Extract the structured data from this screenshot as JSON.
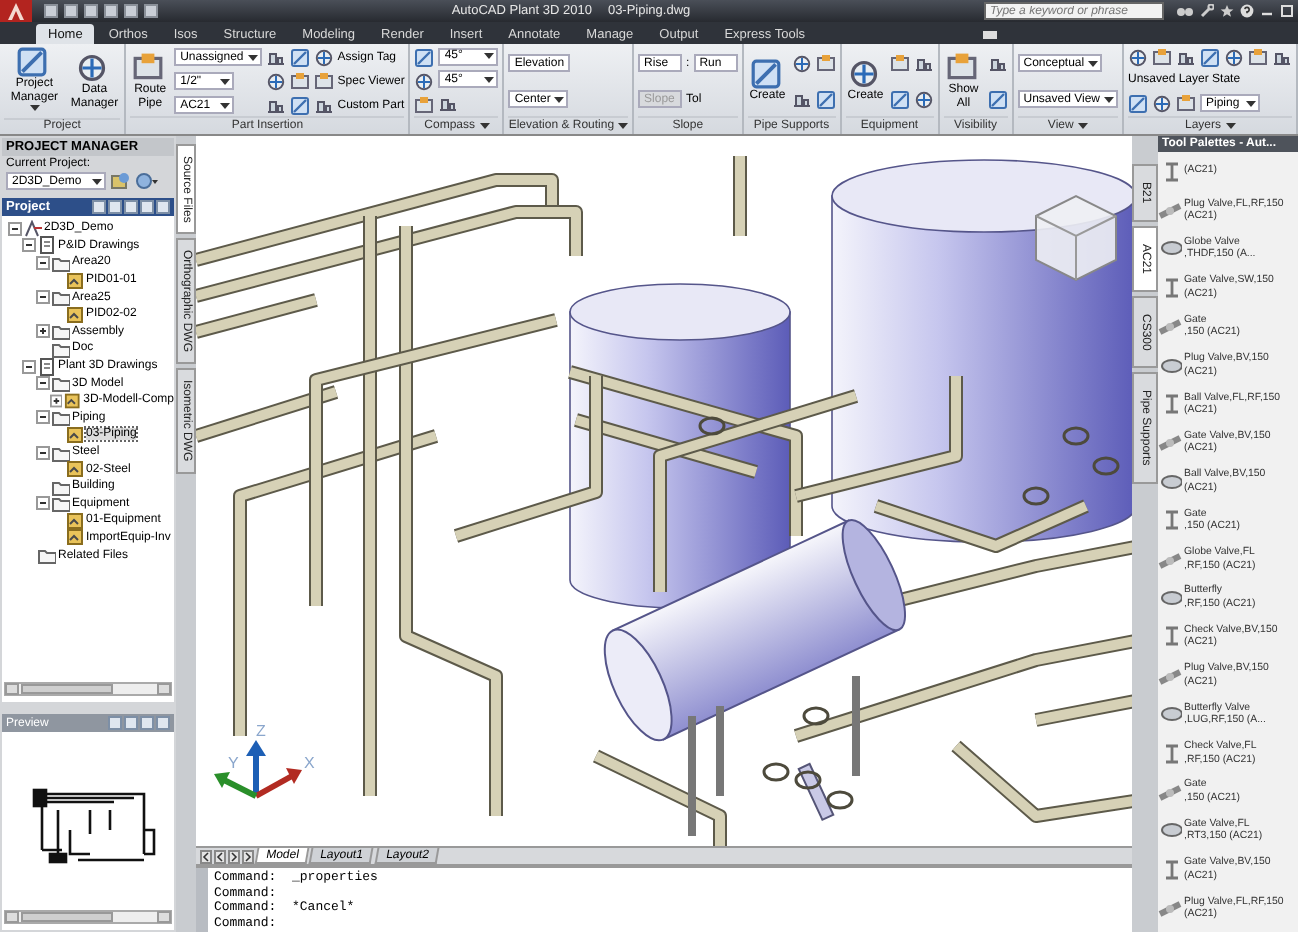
{
  "window": {
    "title": "AutoCAD Plant 3D 2010",
    "document": "03-Piping.dwg"
  },
  "search": {
    "placeholder": "Type a keyword or phrase"
  },
  "tabs": [
    {
      "label": "Home",
      "selected": true
    },
    {
      "label": "Orthos",
      "selected": false
    },
    {
      "label": "Isos",
      "selected": false
    },
    {
      "label": "Structure",
      "selected": false
    },
    {
      "label": "Modeling",
      "selected": false
    },
    {
      "label": "Render",
      "selected": false
    },
    {
      "label": "Insert",
      "selected": false
    },
    {
      "label": "Annotate",
      "selected": false
    },
    {
      "label": "Manage",
      "selected": false
    },
    {
      "label": "Output",
      "selected": false
    },
    {
      "label": "Express Tools",
      "selected": false
    }
  ],
  "ribbon": {
    "panels": [
      {
        "title": "Project",
        "caret": false,
        "columns": [
          [
            {
              "kind": "big",
              "lines": [
                "Project",
                "Manager"
              ],
              "caret": true
            }
          ],
          [
            {
              "kind": "big",
              "lines": [
                "Data",
                "Manager"
              ],
              "caret": false
            }
          ]
        ]
      },
      {
        "title": "Part Insertion",
        "caret": false,
        "columns": [
          [
            {
              "kind": "big",
              "lines": [
                "Route",
                "Pipe"
              ],
              "caret": false
            }
          ],
          [
            {
              "kind": "dropdown",
              "value": "Unassigned"
            },
            {
              "kind": "dropdown",
              "value": "1/2\""
            },
            {
              "kind": "dropdown",
              "value": "AC21"
            }
          ],
          [
            {
              "kind": "row",
              "items": [
                {
                  "kind": "icon"
                },
                {
                  "kind": "icon"
                }
              ]
            },
            {
              "kind": "row",
              "items": [
                {
                  "kind": "icon"
                },
                {
                  "kind": "icon"
                }
              ]
            },
            {
              "kind": "row",
              "items": [
                {
                  "kind": "icon"
                },
                {
                  "kind": "icon"
                }
              ]
            }
          ],
          [
            {
              "kind": "tool",
              "label": "Assign Tag"
            },
            {
              "kind": "tool",
              "label": "Spec Viewer"
            },
            {
              "kind": "tool",
              "label": "Custom Part"
            }
          ]
        ]
      },
      {
        "title": "Compass",
        "caret": true,
        "columns": [
          [
            {
              "kind": "icon"
            },
            {
              "kind": "icon"
            },
            {
              "kind": "icon"
            }
          ],
          [
            {
              "kind": "dropdown",
              "value": "45°"
            },
            {
              "kind": "dropdown",
              "value": "45°"
            },
            {
              "kind": "icon"
            }
          ]
        ]
      },
      {
        "title": "Elevation & Routing",
        "caret": true,
        "columns": [
          [
            {
              "kind": "field",
              "value": "Elevation",
              "disabled": false
            },
            {
              "kind": "dropdown",
              "value": "Center"
            }
          ]
        ]
      },
      {
        "title": "Slope",
        "caret": false,
        "columns": [
          [
            {
              "kind": "row",
              "items": [
                {
                  "kind": "field",
                  "value": "Rise",
                  "disabled": false
                },
                {
                  "kind": "label",
                  "text": ":"
                },
                {
                  "kind": "field",
                  "value": "Run",
                  "disabled": false
                }
              ]
            },
            {
              "kind": "row",
              "items": [
                {
                  "kind": "field",
                  "value": "Slope",
                  "disabled": true
                },
                {
                  "kind": "label",
                  "text": "Tol"
                }
              ]
            }
          ]
        ]
      },
      {
        "title": "Pipe Supports",
        "caret": false,
        "columns": [
          [
            {
              "kind": "big",
              "lines": [
                "Create"
              ],
              "caret": false
            }
          ],
          [
            {
              "kind": "row",
              "items": [
                {
                  "kind": "icon"
                },
                {
                  "kind": "icon"
                }
              ]
            },
            {
              "kind": "row",
              "items": [
                {
                  "kind": "icon"
                },
                {
                  "kind": "icon"
                }
              ]
            }
          ]
        ]
      },
      {
        "title": "Equipment",
        "caret": false,
        "columns": [
          [
            {
              "kind": "big",
              "lines": [
                "Create"
              ],
              "caret": false
            }
          ],
          [
            {
              "kind": "row",
              "items": [
                {
                  "kind": "icon"
                },
                {
                  "kind": "icon"
                }
              ]
            },
            {
              "kind": "row",
              "items": [
                {
                  "kind": "icon"
                },
                {
                  "kind": "icon"
                }
              ]
            }
          ]
        ]
      },
      {
        "title": "Visibility",
        "caret": false,
        "columns": [
          [
            {
              "kind": "big",
              "lines": [
                "Show",
                "All"
              ],
              "caret": false
            }
          ],
          [
            {
              "kind": "icon"
            },
            {
              "kind": "icon"
            }
          ]
        ]
      },
      {
        "title": "View",
        "caret": true,
        "columns": [
          [
            {
              "kind": "dropdown",
              "value": "Conceptual"
            },
            {
              "kind": "dropdown",
              "value": "Unsaved View"
            }
          ]
        ]
      },
      {
        "title": "Layers",
        "caret": true,
        "columns": [
          [
            {
              "kind": "row",
              "items": [
                {
                  "kind": "icon"
                },
                {
                  "kind": "icon"
                },
                {
                  "kind": "icon"
                },
                {
                  "kind": "icon"
                },
                {
                  "kind": "icon"
                },
                {
                  "kind": "icon"
                },
                {
                  "kind": "icon"
                }
              ]
            },
            {
              "kind": "label",
              "text": "Unsaved Layer State"
            },
            {
              "kind": "row",
              "items": [
                {
                  "kind": "icon"
                },
                {
                  "kind": "icon"
                },
                {
                  "kind": "icon"
                },
                {
                  "kind": "dropdown",
                  "value": "Piping"
                }
              ]
            }
          ]
        ]
      }
    ]
  },
  "project_manager": {
    "title": "PROJECT MANAGER",
    "current_label": "Current Project:",
    "current_project": "2D3D_Demo",
    "tree_title": "Project",
    "tree": [
      {
        "kind": "project",
        "label": "2D3D_Demo",
        "selected": false,
        "expanded": true,
        "children": [
          {
            "kind": "set",
            "label": "P&ID Drawings",
            "selected": false,
            "expanded": true,
            "children": [
              {
                "kind": "folder",
                "label": "Area20",
                "selected": false,
                "expanded": true,
                "children": [
                  {
                    "kind": "drawing",
                    "label": "PID01-01",
                    "selected": false
                  }
                ]
              },
              {
                "kind": "folder",
                "label": "Area25",
                "selected": false,
                "expanded": true,
                "children": [
                  {
                    "kind": "drawing",
                    "label": "PID02-02",
                    "selected": false
                  }
                ]
              },
              {
                "kind": "folder",
                "label": "Assembly",
                "selected": false,
                "expanded": false
              },
              {
                "kind": "folder",
                "label": "Doc",
                "selected": false
              }
            ]
          },
          {
            "kind": "set",
            "label": "Plant 3D Drawings",
            "selected": false,
            "expanded": true,
            "children": [
              {
                "kind": "folder",
                "label": "3D Model",
                "selected": false,
                "expanded": true,
                "children": [
                  {
                    "kind": "drawing",
                    "label": "3D-Modell-Comp",
                    "selected": false,
                    "expanded": false
                  }
                ]
              },
              {
                "kind": "folder",
                "label": "Piping",
                "selected": false,
                "expanded": true,
                "children": [
                  {
                    "kind": "drawing",
                    "label": "03-Piping",
                    "selected": true
                  }
                ]
              },
              {
                "kind": "folder",
                "label": "Steel",
                "selected": false,
                "expanded": true,
                "children": [
                  {
                    "kind": "drawing",
                    "label": "02-Steel",
                    "selected": false
                  }
                ]
              },
              {
                "kind": "folder",
                "label": "Building",
                "selected": false
              },
              {
                "kind": "folder",
                "label": "Equipment",
                "selected": false,
                "expanded": true,
                "children": [
                  {
                    "kind": "drawing",
                    "label": "01-Equipment",
                    "selected": false
                  },
                  {
                    "kind": "drawing",
                    "label": "ImportEquip-Inv",
                    "selected": false
                  }
                ]
              }
            ]
          },
          {
            "kind": "folder",
            "label": "Related Files",
            "selected": false
          }
        ]
      }
    ],
    "preview_title": "Preview"
  },
  "side_tabs": [
    {
      "label": "Source Files",
      "selected": true
    },
    {
      "label": "Orthographic DWG",
      "selected": false
    },
    {
      "label": "Isometric DWG",
      "selected": false
    }
  ],
  "ucs_labels": [
    "Y",
    "Z",
    "X"
  ],
  "layout_tabs": [
    {
      "label": "Model",
      "selected": true
    },
    {
      "label": "Layout1",
      "selected": false
    },
    {
      "label": "Layout2",
      "selected": false
    }
  ],
  "command_lines": [
    "Command:  _properties",
    "Command:",
    "Command:  *Cancel*",
    "Command:"
  ],
  "palette_tabs": [
    {
      "label": "B21",
      "selected": false
    },
    {
      "label": "AC21",
      "selected": true
    },
    {
      "label": "CS300",
      "selected": false
    },
    {
      "label": "Pipe Supports",
      "selected": false
    }
  ],
  "palette": {
    "title": "Tool Palettes - Aut...",
    "items": [
      {
        "lines": [
          "(AC21)"
        ]
      },
      {
        "lines": [
          "Plug Valve,FL,RF,150",
          "(AC21)"
        ]
      },
      {
        "lines": [
          "Globe Valve",
          ",THDF,150 (A..."
        ]
      },
      {
        "lines": [
          "Gate Valve,SW,150",
          "(AC21)"
        ]
      },
      {
        "lines": [
          "Gate",
          ",150 (AC21)"
        ]
      },
      {
        "lines": [
          "Plug Valve,BV,150",
          "(AC21)"
        ]
      },
      {
        "lines": [
          "Ball Valve,FL,RF,150",
          "(AC21)"
        ]
      },
      {
        "lines": [
          "Gate Valve,BV,150",
          "(AC21)"
        ]
      },
      {
        "lines": [
          "Ball Valve,BV,150",
          "(AC21)"
        ]
      },
      {
        "lines": [
          "Gate",
          ",150 (AC21)"
        ]
      },
      {
        "lines": [
          "Globe Valve,FL",
          ",RF,150 (AC21)"
        ]
      },
      {
        "lines": [
          "Butterfly",
          ",RF,150 (AC21)"
        ]
      },
      {
        "lines": [
          "Check Valve,BV,150",
          "(AC21)"
        ]
      },
      {
        "lines": [
          "Plug Valve,BV,150",
          "(AC21)"
        ]
      },
      {
        "lines": [
          "Butterfly Valve",
          ",LUG,RF,150 (A..."
        ]
      },
      {
        "lines": [
          "Check Valve,FL",
          ",RF,150 (AC21)"
        ]
      },
      {
        "lines": [
          "Gate",
          ",150 (AC21)"
        ]
      },
      {
        "lines": [
          "Gate Valve,FL",
          ",RT3,150 (AC21)"
        ]
      },
      {
        "lines": [
          "Gate Valve,BV,150",
          "(AC21)"
        ]
      },
      {
        "lines": [
          "Plug Valve,FL,RF,150",
          "(AC21)"
        ]
      }
    ]
  }
}
